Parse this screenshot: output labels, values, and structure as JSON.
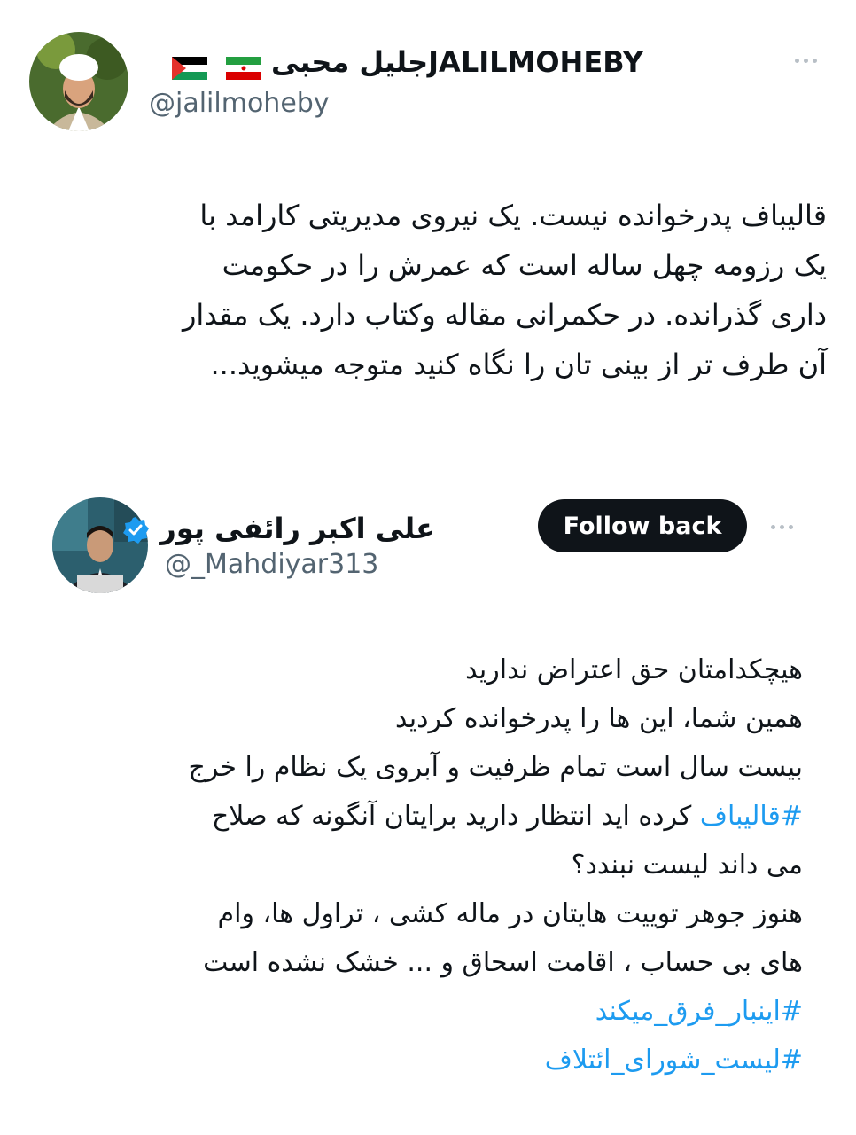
{
  "tweet": {
    "author": {
      "display_name": "جلیل محبیJALILMOHEBY",
      "handle": "@jalilmoheby",
      "flags": [
        "palestine-flag",
        "iran-flag"
      ]
    },
    "more_icon": "more-dots-icon",
    "text_lines": [
      "قالیباف پدرخوانده نیست. یک نیروی مدیریتی کارامد با",
      "یک رزومه چهل ساله است که عمرش را در حکومت",
      "داری گذرانده. در حکمرانی مقاله وکتاب دارد. یک مقدار",
      "آن طرف تر از بینی تان را نگاه کنید متوجه میشوید..."
    ]
  },
  "quoted": {
    "author": {
      "display_name": "علی اکبر رائفی پور",
      "handle": "@_Mahdiyar313",
      "verified_icon": "verified-badge-icon"
    },
    "follow_label": "Follow back",
    "more_icon": "more-dots-icon",
    "text_lines": [
      {
        "text": "هیچکدامتان حق اعتراض ندارید"
      },
      {
        "text": "همین شما، این ها را پدرخوانده کردید"
      },
      {
        "text": "بیست سال است تمام ظرفیت و آبروی یک نظام را خرج"
      },
      {
        "tag": "#قالیباف",
        "text": " کرده اید انتظار دارید برایتان آنگونه که صلاح"
      },
      {
        "text": "می داند لیست نبندد؟"
      },
      {
        "text": "هنوز جوهر توییت هایتان در ماله کشی ، تراول ها، وام"
      },
      {
        "text": "های بی حساب ، اقامت اسحاق و ... خشک نشده است"
      }
    ],
    "hashtags": [
      "#اینبار_فرق_میکند",
      "#لیست_شورای_ائتلاف"
    ]
  },
  "colors": {
    "link": "#1d9bf0",
    "secondary_text": "#536471",
    "button_bg": "#0f1419"
  }
}
